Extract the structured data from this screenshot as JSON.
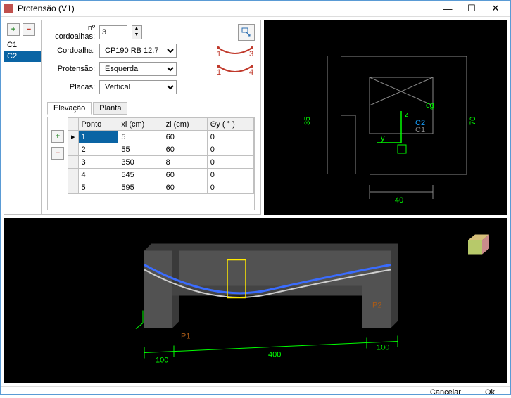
{
  "window": {
    "title": "Protensão (V1)"
  },
  "sidebar": {
    "items": [
      {
        "label": "C1",
        "selected": false
      },
      {
        "label": "C2",
        "selected": true
      }
    ]
  },
  "form": {
    "ncordoalhas_label": "nº cordoalhas:",
    "ncordoalhas_value": "3",
    "cordoalha_label": "Cordoalha:",
    "cordoalha_value": "CP190 RB 12.7",
    "protensao_label": "Protensão:",
    "protensao_value": "Esquerda",
    "placas_label": "Placas:",
    "placas_value": "Vertical",
    "tendon_top": {
      "left": "1",
      "right": "3"
    },
    "tendon_bot": {
      "left": "1",
      "right": "4"
    }
  },
  "tabs": {
    "elevacao": "Elevação",
    "planta": "Planta",
    "active": 0
  },
  "table": {
    "headers": [
      "Ponto",
      "xi (cm)",
      "zi (cm)",
      "Θy ( ° )"
    ],
    "rows": [
      [
        "1",
        "5",
        "60",
        "0"
      ],
      [
        "2",
        "55",
        "60",
        "0"
      ],
      [
        "3",
        "350",
        "8",
        "0"
      ],
      [
        "4",
        "545",
        "60",
        "0"
      ],
      [
        "5",
        "595",
        "60",
        "0"
      ]
    ],
    "selected_row": 0,
    "selected_col": 0
  },
  "viewport2d": {
    "dims": {
      "h_full": "70",
      "h_half": "35",
      "w": "40"
    },
    "labels": {
      "cg": "cg",
      "c1": "C1",
      "c2": "C2",
      "y": "y",
      "z": "z"
    }
  },
  "viewport3d": {
    "p1": "P1",
    "p2": "P2",
    "len1": "100",
    "len2": "400",
    "len3": "100"
  },
  "footer": {
    "cancel": "Cancelar",
    "ok": "Ok"
  }
}
